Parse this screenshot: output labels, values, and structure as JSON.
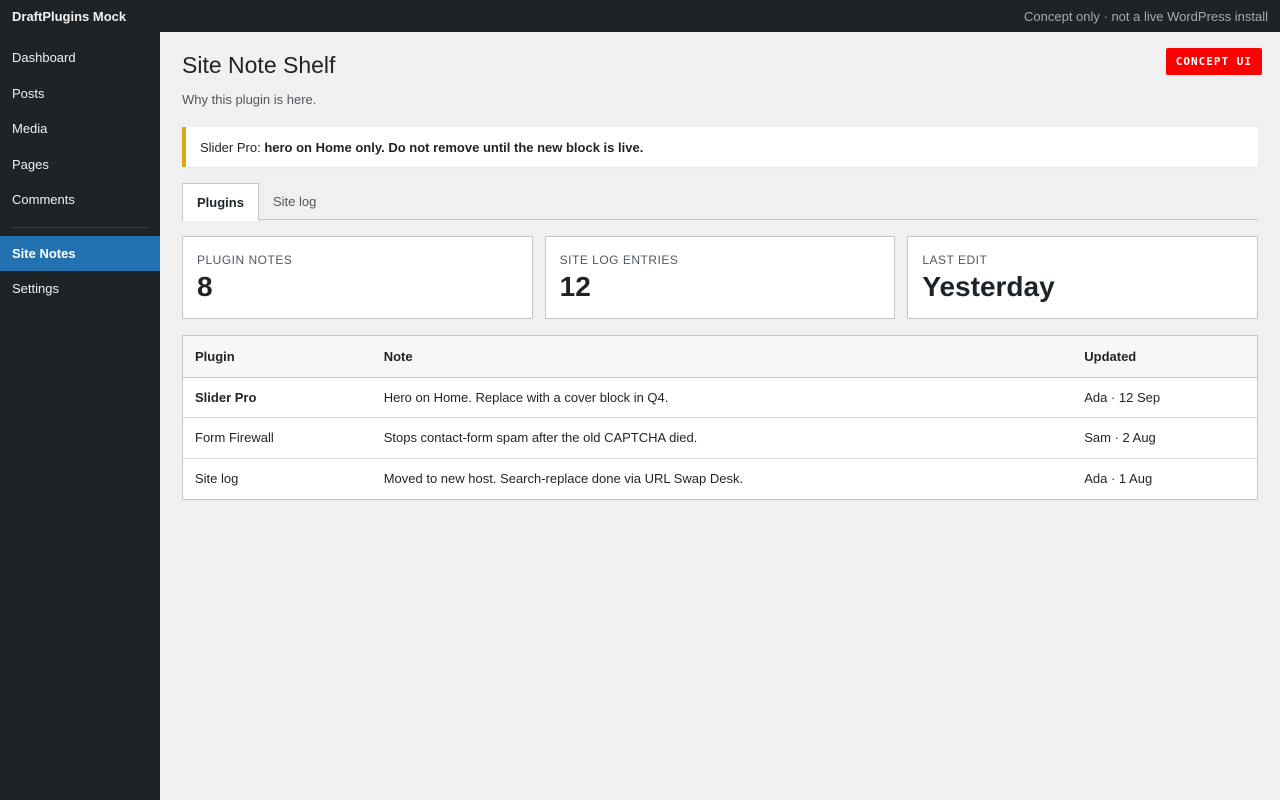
{
  "topbar": {
    "brand": "DraftPlugins Mock",
    "notice": "Concept only · not a live WordPress install"
  },
  "sidebar": {
    "items": [
      {
        "label": "Dashboard"
      },
      {
        "label": "Posts"
      },
      {
        "label": "Media"
      },
      {
        "label": "Pages"
      },
      {
        "label": "Comments"
      },
      {
        "label": "Site Notes",
        "active": true
      },
      {
        "label": "Settings"
      }
    ]
  },
  "page": {
    "badge": "CONCEPT UI",
    "title": "Site Note Shelf",
    "subtitle": "Why this plugin is here.",
    "notice_prefix": "Slider Pro: ",
    "notice_bold": "hero on Home only. Do not remove until the new block is live."
  },
  "tabs": [
    {
      "label": "Plugins",
      "active": true
    },
    {
      "label": "Site log"
    }
  ],
  "stats": [
    {
      "label": "Plugin notes",
      "value": "8"
    },
    {
      "label": "Site log entries",
      "value": "12"
    },
    {
      "label": "Last edit",
      "value": "Yesterday"
    }
  ],
  "table": {
    "headers": [
      "Plugin",
      "Note",
      "Updated"
    ],
    "rows": [
      {
        "plugin": "Slider Pro",
        "note": "Hero on Home. Replace with a cover block in Q4.",
        "updated": "Ada · 12 Sep"
      },
      {
        "plugin": "Form Firewall",
        "note": "Stops contact-form spam after the old CAPTCHA died.",
        "updated": "Sam · 2 Aug"
      },
      {
        "plugin": "Site log",
        "note": "Moved to new host. Search-replace done via URL Swap Desk.",
        "updated": "Ada · 1 Aug"
      }
    ]
  },
  "colors": {
    "admin_dark": "#1d2327",
    "accent_blue": "#2271b1",
    "notice_warning": "#dba617",
    "badge_red": "#ff0000"
  }
}
